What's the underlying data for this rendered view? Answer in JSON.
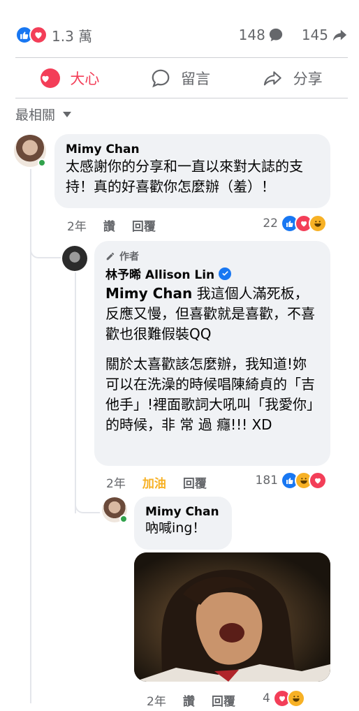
{
  "stats": {
    "reaction_count": "1.3 萬",
    "comment_count": "148",
    "share_count": "145"
  },
  "actions": {
    "like_label": "大心",
    "comment_label": "留言",
    "share_label": "分享"
  },
  "sort": {
    "label": "最相關"
  },
  "comments": [
    {
      "author": "Mimy Chan",
      "text": "太感謝你的分享和一直以來對大誌的支持！真的好喜歡你怎麼辦（羞）！",
      "time": "2年",
      "like_label": "讚",
      "reply_label": "回覆",
      "reaction_count": "22"
    },
    {
      "author_tag": "作者",
      "author": "林予晞 Allison Lin",
      "mention": "Mimy Chan",
      "text1": " 我這個人滿死板，反應又慢，但喜歡就是喜歡，不喜歡也很難假裝QQ",
      "text2": "關於太喜歡該怎麼辦，我知道!妳可以在洗澡的時候唱陳綺貞的「吉他手」!裡面歌詞大吼叫「我愛你」的時候，非 常 過 癮!!! XD",
      "time": "2年",
      "like_label": "加油",
      "reply_label": "回覆",
      "reaction_count": "181"
    },
    {
      "author": "Mimy Chan",
      "text": "吶喊ing！",
      "time": "2年",
      "like_label": "讚",
      "reply_label": "回覆",
      "reaction_count": "4"
    }
  ],
  "colors": {
    "like_blue": "#1877f2",
    "love_red": "#f33e58",
    "haha_yellow": "#f7b125",
    "bubble_bg": "#f0f2f5",
    "secondary_text": "#65676b"
  }
}
